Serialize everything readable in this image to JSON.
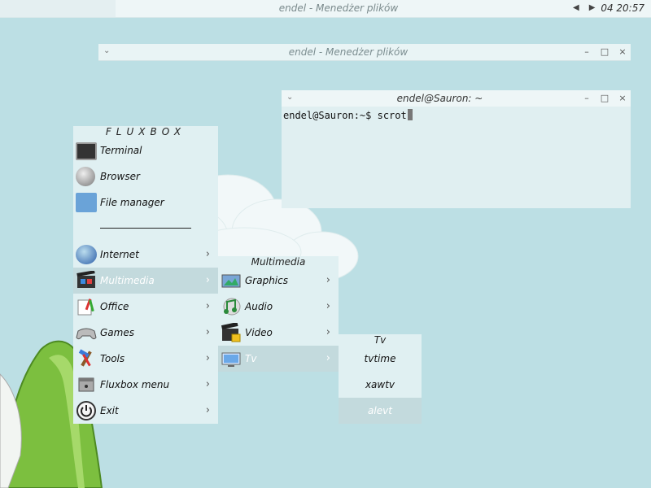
{
  "toolbar": {
    "title": "endel - Menedżer plików",
    "clock": "04 20:57",
    "prev_glyph": "◀",
    "next_glyph": "▶"
  },
  "file_manager_window": {
    "title": "endel - Menedżer plików",
    "pin_glyph": "⌄",
    "min_glyph": "–",
    "max_glyph": "□",
    "close_glyph": "×"
  },
  "terminal_window": {
    "title": "endel@Sauron: ~",
    "pin_glyph": "⌄",
    "min_glyph": "–",
    "max_glyph": "□",
    "close_glyph": "×",
    "prompt": "endel@Sauron:~$ ",
    "command": "scrot"
  },
  "main_menu": {
    "title": "FLUXBOX",
    "items": [
      {
        "label": "Terminal",
        "icon": "terminal-icon"
      },
      {
        "label": "Browser",
        "icon": "globe-icon"
      },
      {
        "label": "File manager",
        "icon": "folder-icon"
      },
      {
        "label": "Internet",
        "icon": "internet-icon"
      },
      {
        "label": "Multimedia",
        "icon": "multimedia-icon"
      },
      {
        "label": "Office",
        "icon": "office-icon"
      },
      {
        "label": "Games",
        "icon": "games-icon"
      },
      {
        "label": "Tools",
        "icon": "tools-icon"
      },
      {
        "label": "Fluxbox menu",
        "icon": "fluxbox-menu-icon"
      },
      {
        "label": "Exit",
        "icon": "power-icon"
      }
    ],
    "chevron": "›"
  },
  "multimedia_menu": {
    "title": "Multimedia",
    "items": [
      {
        "label": "Graphics",
        "icon": "graphics-icon"
      },
      {
        "label": "Audio",
        "icon": "audio-icon"
      },
      {
        "label": "Video",
        "icon": "video-icon"
      },
      {
        "label": "Tv",
        "icon": "tv-icon"
      }
    ]
  },
  "tv_menu": {
    "title": "Tv",
    "items": [
      {
        "label": "tvtime"
      },
      {
        "label": "xawtv"
      },
      {
        "label": "alevt"
      }
    ]
  },
  "colors": {
    "desktop": "#bcdfe4",
    "menu_bg": "#e0f0f2",
    "menu_selected": "#c3dadd"
  }
}
